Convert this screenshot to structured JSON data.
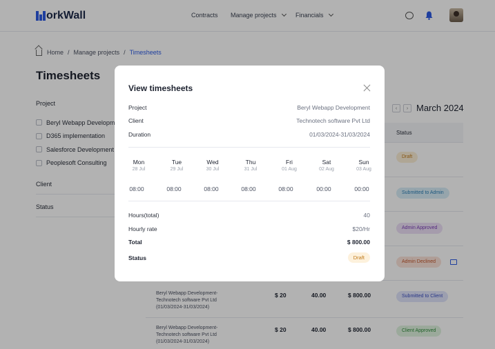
{
  "brand": {
    "logo_text": "orkWall"
  },
  "nav": {
    "contracts": "Contracts",
    "manage_projects": "Manage projects",
    "financials": "Financials"
  },
  "breadcrumb": {
    "home": "Home",
    "sep1": "/",
    "parent": "Manage projects",
    "sep2": "/",
    "current": "Timesheets"
  },
  "page": {
    "title": "Timesheets"
  },
  "filters": {
    "project_heading": "Project",
    "projects": [
      "Beryl Webapp Development",
      "D365 implementation",
      "Salesforce Development",
      "Peoplesoft Consulting"
    ],
    "client_heading": "Client",
    "status_heading": "Status"
  },
  "calendar": {
    "month": "March 2024",
    "prev": "‹",
    "next": "›"
  },
  "table": {
    "status_header": "Status",
    "rows": [
      {
        "status": "Draft"
      },
      {
        "status": "Submitted to Admin"
      },
      {
        "status": "Admin Approved"
      },
      {
        "status": "Admin Declined"
      },
      {
        "desc": "Beryl Webapp Development-Technotech software Pvt Ltd (01/03/2024-31/03/2024)",
        "rate": "$ 20",
        "hours": "40.00",
        "total": "$ 800.00",
        "status": "Submitted to Client"
      },
      {
        "desc": "Beryl Webapp Development-Technotech software Pvt Ltd (01/03/2024-31/03/2024)",
        "rate": "$ 20",
        "hours": "40.00",
        "total": "$ 800.00",
        "status": "Client Approved"
      }
    ]
  },
  "modal": {
    "title": "View timesheets",
    "project_label": "Project",
    "project_value": "Beryl Webapp Development",
    "client_label": "Client",
    "client_value": "Technotech software Pvt Ltd",
    "duration_label": "Duration",
    "duration_value": "01/03/2024-31/03/2024",
    "days": [
      {
        "name": "Mon",
        "date": "28 Jul",
        "hours": "08:00"
      },
      {
        "name": "Tue",
        "date": "29 Jul",
        "hours": "08:00"
      },
      {
        "name": "Wed",
        "date": "30 Jul",
        "hours": "08:00"
      },
      {
        "name": "Thu",
        "date": "31 Jul",
        "hours": "08:00"
      },
      {
        "name": "Fri",
        "date": "01 Aug",
        "hours": "08:00"
      },
      {
        "name": "Sat",
        "date": "02 Aug",
        "hours": "00:00"
      },
      {
        "name": "Sun",
        "date": "03 Aug",
        "hours": "00:00"
      }
    ],
    "hours_total_label": "Hours(total)",
    "hours_total_value": "40",
    "hourly_rate_label": "Hourly rate",
    "hourly_rate_value": "$20/Hr",
    "total_label": "Total",
    "total_value": "$ 800.00",
    "status_label": "Status",
    "status_value": "Draft"
  },
  "colors": {
    "accent": "#2d5be3",
    "overlay": "rgba(0,0,0,0.30)"
  }
}
